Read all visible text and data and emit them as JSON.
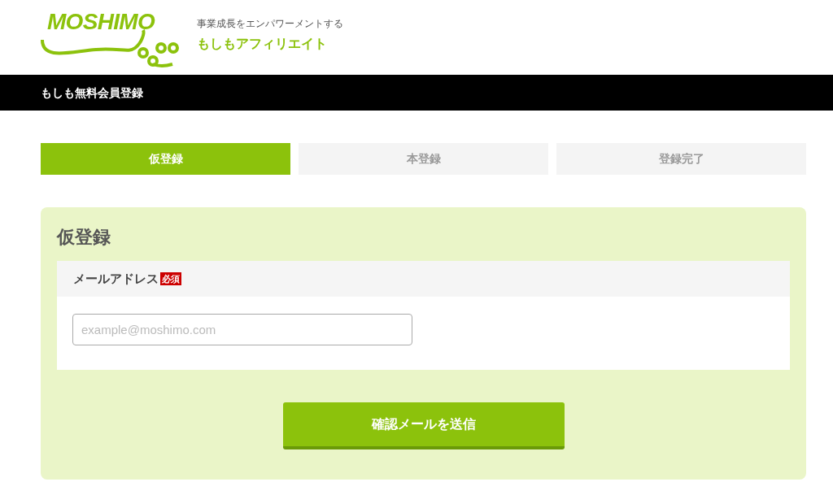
{
  "header": {
    "logo_text": "MOSHIMO",
    "tagline": "事業成長をエンパワーメントする",
    "brand": "もしもアフィリエイト"
  },
  "title_bar": {
    "title": "もしも無料会員登録"
  },
  "steps": [
    {
      "label": "仮登録",
      "selected": true
    },
    {
      "label": "本登録",
      "selected": false
    },
    {
      "label": "登録完了",
      "selected": false
    }
  ],
  "form": {
    "title": "仮登録",
    "field_label": "メールアドレス",
    "required_badge": "必須",
    "email": {
      "placeholder": "example@moshimo.com"
    },
    "submit": "確認メールを送信"
  }
}
